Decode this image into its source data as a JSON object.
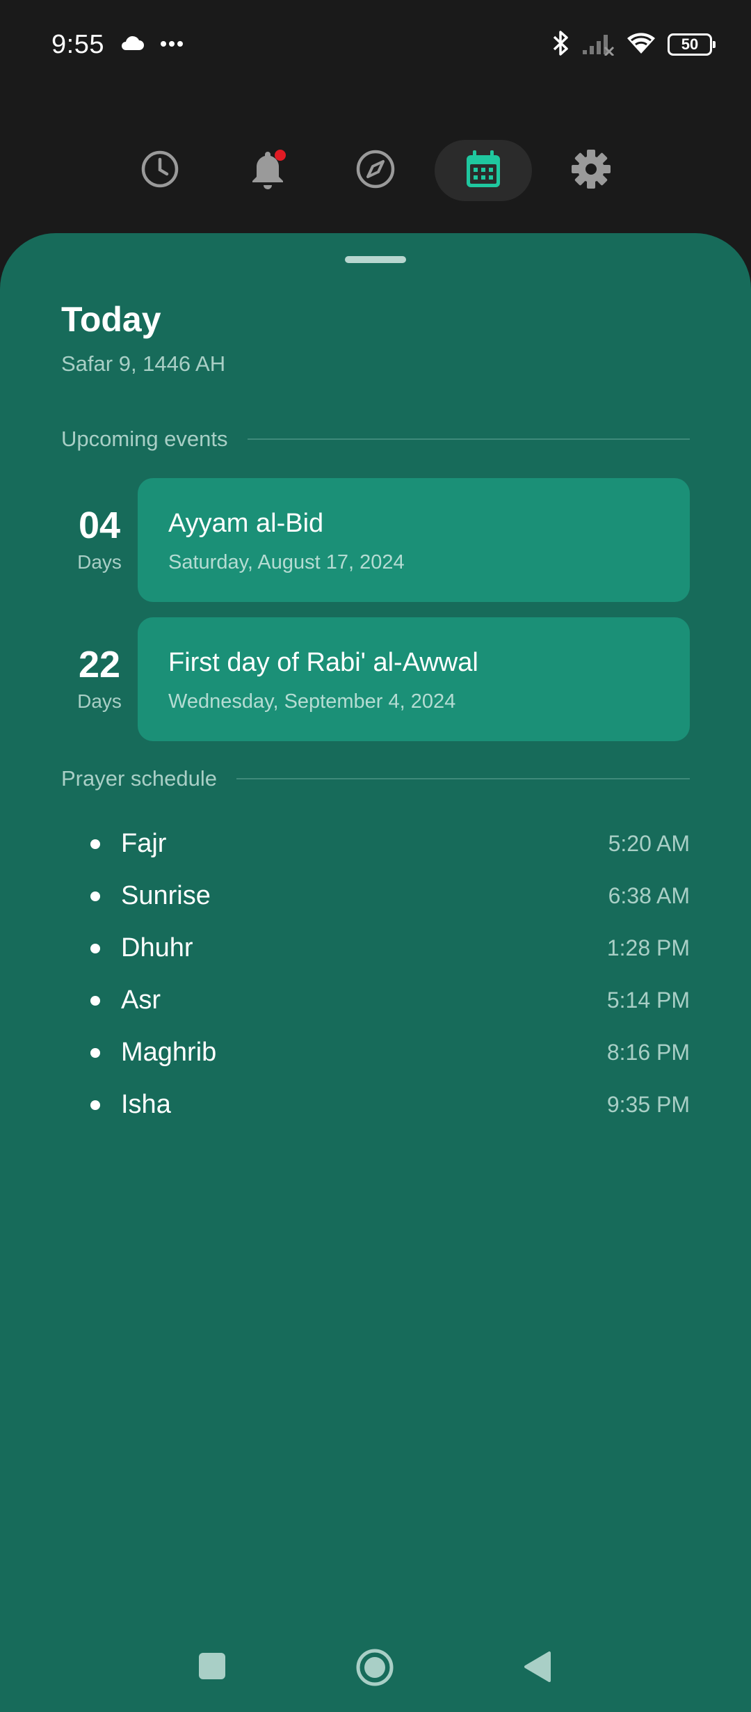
{
  "status_bar": {
    "time": "9:55",
    "battery": "50",
    "icons": [
      "cloud-icon",
      "more-dots-icon",
      "bluetooth-icon",
      "signal-icon",
      "wifi-icon",
      "battery-icon"
    ]
  },
  "top_nav": {
    "tabs": [
      {
        "icon": "clock-icon",
        "active": false
      },
      {
        "icon": "bell-icon",
        "active": false,
        "badge": true
      },
      {
        "icon": "compass-icon",
        "active": false
      },
      {
        "icon": "calendar-icon",
        "active": true
      },
      {
        "icon": "gear-icon",
        "active": false
      }
    ],
    "active_color": "#1fc79f"
  },
  "today": {
    "title": "Today",
    "hijri_date": "Safar 9, 1446 AH"
  },
  "upcoming": {
    "heading": "Upcoming events",
    "events": [
      {
        "count": "04",
        "unit": "Days",
        "title": "Ayyam al-Bid",
        "date": "Saturday, August 17, 2024"
      },
      {
        "count": "22",
        "unit": "Days",
        "title": "First day of Rabi' al-Awwal",
        "date": "Wednesday, September 4, 2024"
      }
    ]
  },
  "prayer": {
    "heading": "Prayer schedule",
    "items": [
      {
        "name": "Fajr",
        "time": "5:20 AM"
      },
      {
        "name": "Sunrise",
        "time": "6:38 AM"
      },
      {
        "name": "Dhuhr",
        "time": "1:28 PM"
      },
      {
        "name": "Asr",
        "time": "5:14 PM"
      },
      {
        "name": "Maghrib",
        "time": "8:16 PM"
      },
      {
        "name": "Isha",
        "time": "9:35 PM"
      }
    ]
  },
  "colors": {
    "sheet": "#176b5a",
    "card": "#1b9077",
    "muted_text": "#a9cfc6",
    "background": "#1a1a1a"
  }
}
